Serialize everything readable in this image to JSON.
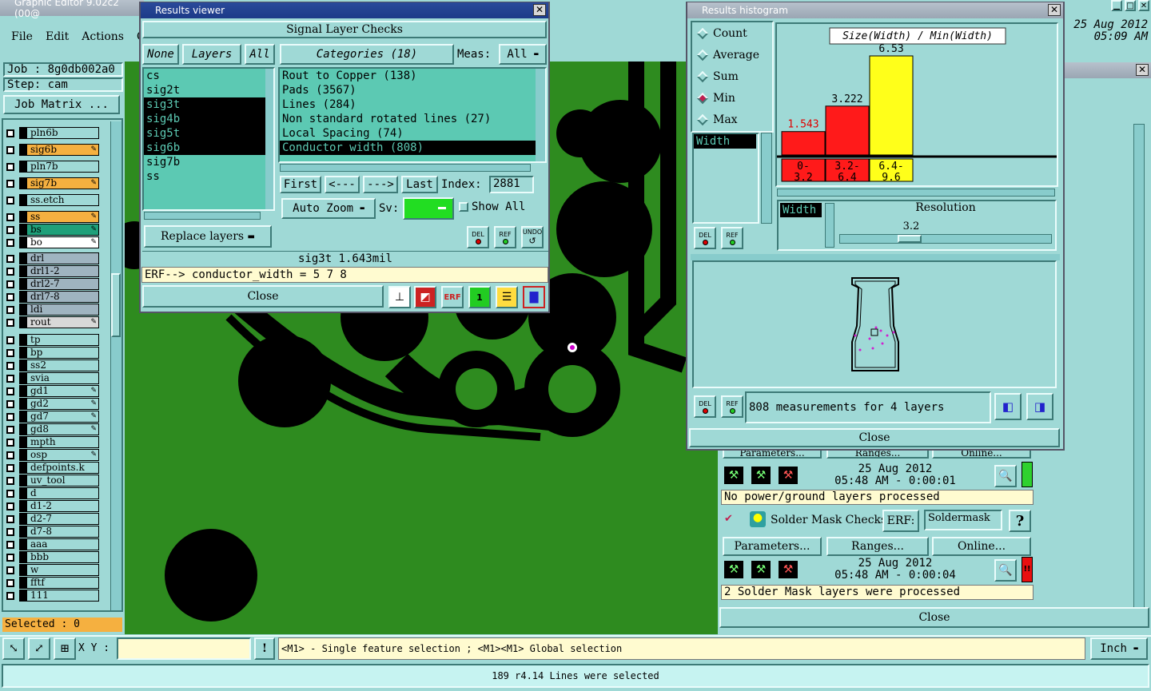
{
  "app": {
    "title": "Graphic Editor 9.02c2 (00@",
    "datetime_date": "25 Aug 2012",
    "datetime_time": "05:09 AM"
  },
  "menu": [
    "File",
    "Edit",
    "Actions",
    "O"
  ],
  "job": {
    "job_label": "Job : 8g0db002a0",
    "step_label": "Step: cam",
    "matrix_button": "Job Matrix ..."
  },
  "layers": [
    {
      "name": "pln6b",
      "color": "#9fd9d6",
      "lock": false
    },
    {
      "name": "sig6b",
      "color": "#f5b040",
      "lock": true
    },
    {
      "name": "pln7b",
      "color": "#9fd9d6",
      "lock": false
    },
    {
      "name": "sig7b",
      "color": "#f5b040",
      "lock": true
    },
    {
      "name": "ss.etch",
      "color": "#9fd9d6",
      "lock": false
    },
    {
      "name": "ss",
      "color": "#f5b040",
      "lock": true
    },
    {
      "name": "bs",
      "color": "#1fa07a",
      "lock": true
    },
    {
      "name": "bo",
      "color": "#ffffff",
      "lock": true
    },
    {
      "name": "drl",
      "color": "#9fb4c0",
      "lock": false
    },
    {
      "name": "drl1-2",
      "color": "#9fb4c0",
      "lock": false
    },
    {
      "name": "drl2-7",
      "color": "#9fb4c0",
      "lock": false
    },
    {
      "name": "drl7-8",
      "color": "#9fb4c0",
      "lock": false
    },
    {
      "name": "ldi",
      "color": "#9fb4c0",
      "lock": false
    },
    {
      "name": "rout",
      "color": "#d8d8d8",
      "lock": true
    },
    {
      "name": "tp",
      "color": "#9fd9d6",
      "lock": false
    },
    {
      "name": "bp",
      "color": "#9fd9d6",
      "lock": false
    },
    {
      "name": "ss2",
      "color": "#9fd9d6",
      "lock": false
    },
    {
      "name": "svia",
      "color": "#9fd9d6",
      "lock": false
    },
    {
      "name": "gd1",
      "color": "#9fd9d6",
      "lock": true
    },
    {
      "name": "gd2",
      "color": "#9fd9d6",
      "lock": true
    },
    {
      "name": "gd7",
      "color": "#9fd9d6",
      "lock": true
    },
    {
      "name": "gd8",
      "color": "#9fd9d6",
      "lock": true
    },
    {
      "name": "mpth",
      "color": "#9fd9d6",
      "lock": false
    },
    {
      "name": "osp",
      "color": "#9fd9d6",
      "lock": true
    },
    {
      "name": "defpoints.k",
      "color": "#9fd9d6",
      "lock": false
    },
    {
      "name": "uv_tool",
      "color": "#9fd9d6",
      "lock": false
    },
    {
      "name": "d",
      "color": "#9fd9d6",
      "lock": false
    },
    {
      "name": "d1-2",
      "color": "#9fd9d6",
      "lock": false
    },
    {
      "name": "d2-7",
      "color": "#9fd9d6",
      "lock": false
    },
    {
      "name": "d7-8",
      "color": "#9fd9d6",
      "lock": false
    },
    {
      "name": "aaa",
      "color": "#9fd9d6",
      "lock": false
    },
    {
      "name": "bbb",
      "color": "#9fd9d6",
      "lock": false
    },
    {
      "name": "w",
      "color": "#9fd9d6",
      "lock": false
    },
    {
      "name": "fftf",
      "color": "#9fd9d6",
      "lock": false
    },
    {
      "name": "111",
      "color": "#9fd9d6",
      "lock": false
    }
  ],
  "selected_label": "Selected : 0",
  "results_viewer": {
    "title": "Results viewer",
    "header": "Signal Layer Checks",
    "none_btn": "None",
    "layers_btn": "Layers",
    "all_btn": "All",
    "layer_list": [
      "cs",
      "sig2t",
      "sig3t",
      "sig4b",
      "sig5t",
      "sig6b",
      "sig7b",
      "ss"
    ],
    "selected_layers": [
      "sig3t",
      "sig4b",
      "sig5t",
      "sig6b"
    ],
    "categories_btn": "Categories (18)",
    "meas_label": "Meas:",
    "meas_value": "All",
    "categories": [
      "Rout to Copper (138)",
      "Pads (3567)",
      "Lines (284)",
      "Non standard rotated lines (27)",
      "Local Spacing (74)",
      "Conductor width (808)"
    ],
    "selected_category": "Conductor width (808)",
    "first_btn": "First",
    "prev_btn": "<---",
    "next_btn": "--->",
    "last_btn": "Last",
    "index_label": "Index:",
    "index_value": "2881",
    "autozoom": "Auto Zoom",
    "sv_label": "Sv:",
    "show_all": "Show All",
    "replace_layers": "Replace layers",
    "del": "DEL",
    "ref": "REF",
    "undo": "UNDO",
    "status": "sig3t 1.643mil",
    "erf": "ERF--> conductor_width = 5 7 8",
    "close": "Close"
  },
  "histogram": {
    "title": "Results histogram",
    "modes": [
      "Count",
      "Average",
      "Sum",
      "Min",
      "Max"
    ],
    "selected_mode": "Min",
    "field": "Width",
    "chart_title": "Size(Width) / Min(Width)",
    "resolution_label": "Resolution",
    "resolution_value": "3.2",
    "resolution_field": "Width",
    "measurements": "808 measurements for 4 layers",
    "del": "DEL",
    "ref": "REF",
    "close": "Close"
  },
  "chart_data": {
    "type": "bar",
    "title": "Size(Width) / Min(Width)",
    "categories": [
      "0-3.2",
      "3.2-6.4",
      "6.4-9.6"
    ],
    "values": [
      1.543,
      3.222,
      6.53
    ],
    "value_labels": [
      "1.543",
      "3.222",
      "6.53"
    ],
    "bin_labels": [
      "0-\n3.2",
      "3.2-\n6.4",
      "6.4-\n9.6"
    ],
    "colors": [
      "#ff1a1a",
      "#ff1a1a",
      "#ffff1a"
    ],
    "label_colors": [
      "#e00000",
      "#000000",
      "#000000"
    ],
    "ylim": [
      0,
      6.53
    ]
  },
  "checks": {
    "params_btn": "Parameters...",
    "ranges_btn": "Ranges...",
    "online_btn": "Online...",
    "pg_date": "25 Aug 2012",
    "pg_time": "05:48 AM - 0:00:01",
    "pg_status": "No power/ground layers processed",
    "sm_title": "Solder Mask Checks",
    "sm_erf_label": "ERF:",
    "sm_erf_value": "Soldermask",
    "sm_date": "25 Aug 2012",
    "sm_time": "05:48 AM - 0:00:04",
    "sm_status": "2 Solder Mask layers were processed",
    "help": "?",
    "warn": "!!",
    "close": "Close"
  },
  "bottom": {
    "xy_label": "X Y :",
    "xy_value": "",
    "warn_btn": "!",
    "hint": "<M1> - Single feature selection ; <M1><M1> Global selection",
    "units": "Inch",
    "status": "189 r4.14 Lines were selected"
  }
}
